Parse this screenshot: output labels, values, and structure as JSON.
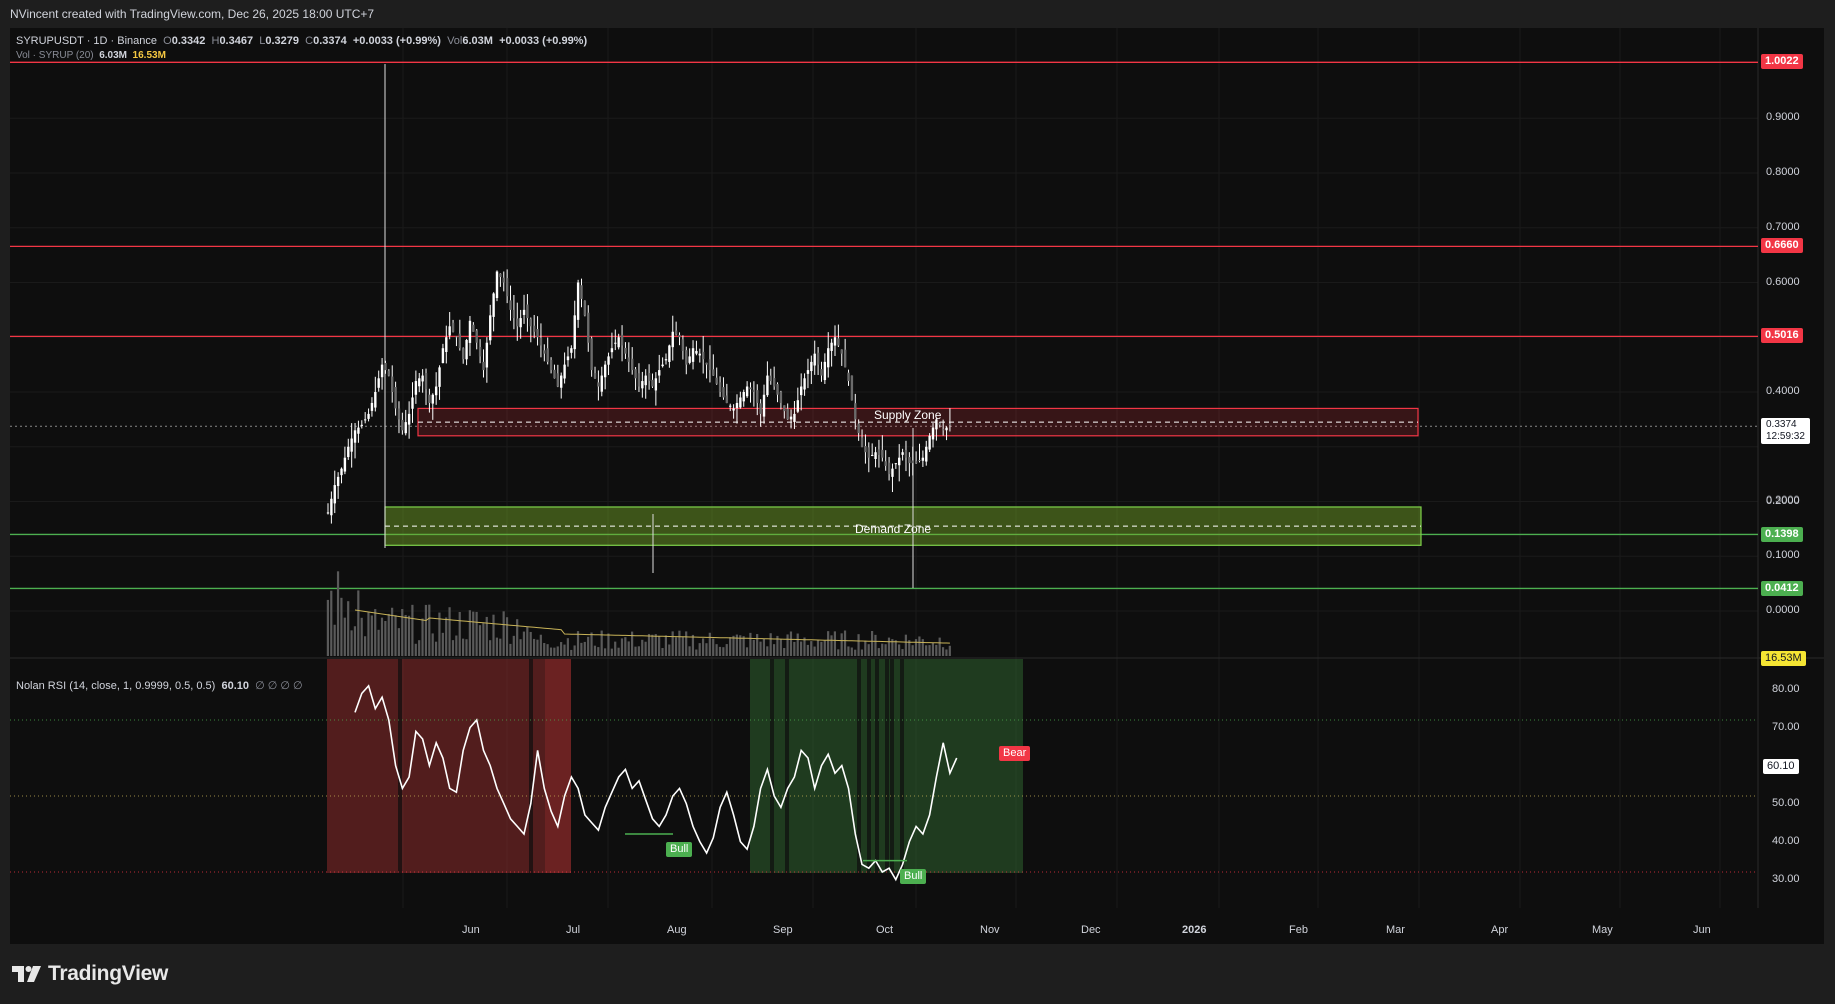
{
  "header": {
    "attribution": "NVincent created with TradingView.com, Dec 26, 2025 18:00 UTC+7"
  },
  "legend": {
    "symbol": "SYRUPUSDT · 1D · Binance",
    "o_label": "O",
    "o_value": "0.3342",
    "h_label": "H",
    "h_value": "0.3467",
    "l_label": "L",
    "l_value": "0.3279",
    "c_label": "C",
    "c_value": "0.3374",
    "change": "+0.0033 (+0.99%)",
    "vol_label": "Vol",
    "vol_value": "6.03M",
    "vol_change": "+0.0033 (+0.99%)",
    "vol_ind": "Vol · SYRUP (20)",
    "vol_ind_value": "6.03M",
    "vol_ind_ma": "16.53M",
    "rsi_title": "Nolan RSI (14, close, 1, 0.9999, 0.5, 0.5)",
    "rsi_value": "60.10",
    "rsi_extra": "∅ ∅ ∅ ∅"
  },
  "price_axis": [
    "0.9000",
    "0.8000",
    "0.7000",
    "0.6000",
    "0.4000",
    "0.2000",
    "0.1000",
    "0.0000"
  ],
  "price_axis_partial": "0.3000",
  "price_tags": {
    "r1": "1.0022",
    "r2": "0.6660",
    "r3": "0.5016",
    "g1": "0.1398",
    "g2": "0.0412",
    "current": "0.3374",
    "countdown": "12:59:32",
    "volume_ma": "16.53M"
  },
  "rsi_axis": [
    "80.00",
    "70.00",
    "50.00",
    "40.00",
    "30.00"
  ],
  "rsi_tag": "60.10",
  "time_axis": [
    "Jun",
    "Jul",
    "Aug",
    "Sep",
    "Oct",
    "Nov",
    "Dec",
    "2026",
    "Feb",
    "Mar",
    "Apr",
    "May",
    "Jun"
  ],
  "zones": {
    "supply": "Supply Zone",
    "demand": "Demand Zone"
  },
  "signals": {
    "bull1": "Bull",
    "bull2": "Bull",
    "bear": "Bear"
  },
  "footer": {
    "brand": "TradingView"
  },
  "colors": {
    "background": "#0e0e0e",
    "resistance": "#f23645",
    "support": "#4caf50",
    "candles": "#ffffff",
    "volume_ma": "#c9b458",
    "bear_region": "#8b2a2a",
    "bull_region": "#2c5a2c"
  },
  "chart_data": {
    "type": "candlestick",
    "symbol": "SYRUPUSDT",
    "interval": "1D",
    "exchange": "Binance",
    "current_price": 0.3374,
    "horizontal_levels": [
      1.0022,
      0.666,
      0.5016,
      0.1398,
      0.0412
    ],
    "supply_zone": [
      0.32,
      0.37
    ],
    "demand_zone": [
      0.12,
      0.19
    ],
    "close_path": [
      [
        0,
        0.18
      ],
      [
        2,
        0.23
      ],
      [
        4,
        0.26
      ],
      [
        6,
        0.3
      ],
      [
        8,
        0.33
      ],
      [
        10,
        0.34
      ],
      [
        12,
        0.36
      ],
      [
        14,
        0.4
      ],
      [
        16,
        0.45
      ],
      [
        18,
        0.43
      ],
      [
        20,
        0.37
      ],
      [
        22,
        0.33
      ],
      [
        24,
        0.36
      ],
      [
        26,
        0.42
      ],
      [
        28,
        0.43
      ],
      [
        30,
        0.38
      ],
      [
        32,
        0.41
      ],
      [
        34,
        0.48
      ],
      [
        36,
        0.52
      ],
      [
        38,
        0.5
      ],
      [
        40,
        0.46
      ],
      [
        42,
        0.53
      ],
      [
        44,
        0.49
      ],
      [
        46,
        0.44
      ],
      [
        48,
        0.54
      ],
      [
        50,
        0.62
      ],
      [
        52,
        0.6
      ],
      [
        54,
        0.55
      ],
      [
        56,
        0.52
      ],
      [
        58,
        0.55
      ],
      [
        60,
        0.52
      ],
      [
        62,
        0.5
      ],
      [
        64,
        0.47
      ],
      [
        66,
        0.44
      ],
      [
        68,
        0.41
      ],
      [
        70,
        0.45
      ],
      [
        72,
        0.48
      ],
      [
        74,
        0.6
      ],
      [
        76,
        0.54
      ],
      [
        78,
        0.44
      ],
      [
        80,
        0.41
      ],
      [
        82,
        0.45
      ],
      [
        84,
        0.48
      ],
      [
        86,
        0.5
      ],
      [
        88,
        0.47
      ],
      [
        90,
        0.44
      ],
      [
        92,
        0.41
      ],
      [
        94,
        0.43
      ],
      [
        96,
        0.41
      ],
      [
        98,
        0.44
      ],
      [
        100,
        0.46
      ],
      [
        102,
        0.51
      ],
      [
        104,
        0.5
      ],
      [
        106,
        0.45
      ],
      [
        108,
        0.48
      ],
      [
        110,
        0.47
      ],
      [
        112,
        0.45
      ],
      [
        114,
        0.43
      ],
      [
        116,
        0.4
      ],
      [
        118,
        0.38
      ],
      [
        120,
        0.37
      ],
      [
        122,
        0.39
      ],
      [
        124,
        0.41
      ],
      [
        126,
        0.4
      ],
      [
        128,
        0.36
      ],
      [
        130,
        0.43
      ],
      [
        132,
        0.41
      ],
      [
        134,
        0.38
      ],
      [
        136,
        0.35
      ],
      [
        138,
        0.36
      ],
      [
        140,
        0.41
      ],
      [
        142,
        0.44
      ],
      [
        144,
        0.47
      ],
      [
        146,
        0.43
      ],
      [
        148,
        0.48
      ],
      [
        150,
        0.5
      ],
      [
        152,
        0.47
      ],
      [
        154,
        0.42
      ],
      [
        156,
        0.35
      ],
      [
        158,
        0.3
      ],
      [
        160,
        0.28
      ],
      [
        162,
        0.29
      ],
      [
        164,
        0.28
      ],
      [
        166,
        0.25
      ],
      [
        168,
        0.27
      ],
      [
        170,
        0.29
      ],
      [
        172,
        0.27
      ],
      [
        174,
        0.27
      ],
      [
        176,
        0.28
      ],
      [
        178,
        0.32
      ],
      [
        180,
        0.35
      ],
      [
        182,
        0.33
      ],
      [
        184,
        0.34
      ]
    ],
    "rsi_path": [
      [
        8,
        72
      ],
      [
        10,
        77
      ],
      [
        12,
        79
      ],
      [
        14,
        73
      ],
      [
        16,
        76
      ],
      [
        18,
        70
      ],
      [
        20,
        58
      ],
      [
        22,
        52
      ],
      [
        24,
        55
      ],
      [
        26,
        67
      ],
      [
        28,
        65
      ],
      [
        30,
        58
      ],
      [
        32,
        64
      ],
      [
        34,
        60
      ],
      [
        36,
        52
      ],
      [
        38,
        51
      ],
      [
        40,
        62
      ],
      [
        42,
        68
      ],
      [
        44,
        70
      ],
      [
        46,
        62
      ],
      [
        48,
        58
      ],
      [
        50,
        52
      ],
      [
        52,
        48
      ],
      [
        54,
        44
      ],
      [
        56,
        42
      ],
      [
        58,
        40
      ],
      [
        60,
        48
      ],
      [
        62,
        62
      ],
      [
        64,
        52
      ],
      [
        66,
        46
      ],
      [
        68,
        42
      ],
      [
        70,
        50
      ],
      [
        72,
        55
      ],
      [
        74,
        52
      ],
      [
        76,
        45
      ],
      [
        78,
        43
      ],
      [
        80,
        41
      ],
      [
        82,
        47
      ],
      [
        84,
        51
      ],
      [
        86,
        55
      ],
      [
        88,
        57
      ],
      [
        90,
        52
      ],
      [
        92,
        54
      ],
      [
        94,
        49
      ],
      [
        96,
        44
      ],
      [
        98,
        42
      ],
      [
        100,
        45
      ],
      [
        102,
        50
      ],
      [
        104,
        52
      ],
      [
        106,
        48
      ],
      [
        108,
        42
      ],
      [
        110,
        38
      ],
      [
        112,
        35
      ],
      [
        114,
        39
      ],
      [
        116,
        47
      ],
      [
        118,
        51
      ],
      [
        120,
        45
      ],
      [
        122,
        38
      ],
      [
        124,
        36
      ],
      [
        126,
        42
      ],
      [
        128,
        52
      ],
      [
        130,
        57
      ],
      [
        132,
        50
      ],
      [
        134,
        47
      ],
      [
        136,
        52
      ],
      [
        138,
        55
      ],
      [
        140,
        62
      ],
      [
        142,
        60
      ],
      [
        144,
        52
      ],
      [
        146,
        58
      ],
      [
        148,
        61
      ],
      [
        150,
        56
      ],
      [
        152,
        58
      ],
      [
        154,
        52
      ],
      [
        156,
        40
      ],
      [
        158,
        32
      ],
      [
        160,
        31
      ],
      [
        162,
        33
      ],
      [
        164,
        30
      ],
      [
        166,
        31
      ],
      [
        168,
        28
      ],
      [
        170,
        32
      ],
      [
        172,
        38
      ],
      [
        174,
        42
      ],
      [
        176,
        40
      ],
      [
        178,
        45
      ],
      [
        180,
        55
      ],
      [
        182,
        64
      ],
      [
        184,
        56
      ],
      [
        186,
        60
      ]
    ],
    "x_axis_days": "index 0 = mid-May 2025",
    "rsi_levels": [
      70,
      50,
      30
    ],
    "rsi_current": 60.1
  }
}
